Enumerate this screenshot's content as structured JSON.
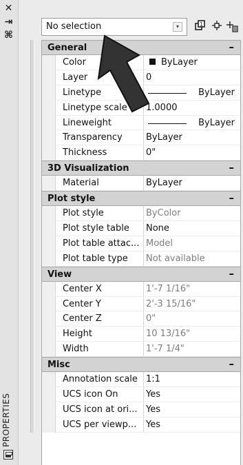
{
  "palette": {
    "title": "PROPERTIES",
    "strip_icons": [
      "close-icon",
      "auto-hide-icon",
      "properties-settings-icon"
    ]
  },
  "toolbar": {
    "selection_value": "No selection",
    "buttons": [
      "toggle-pickadd-icon",
      "select-objects-icon",
      "quick-select-icon"
    ]
  },
  "categories": [
    {
      "label": "General",
      "rows": [
        {
          "name": "Color",
          "value": "ByLayer",
          "type": "color"
        },
        {
          "name": "Layer",
          "value": "0"
        },
        {
          "name": "Linetype",
          "value": "ByLayer",
          "type": "linetype"
        },
        {
          "name": "Linetype scale",
          "value": "1.0000"
        },
        {
          "name": "Lineweight",
          "value": "ByLayer",
          "type": "linetype"
        },
        {
          "name": "Transparency",
          "value": "ByLayer"
        },
        {
          "name": "Thickness",
          "value": "0\""
        }
      ]
    },
    {
      "label": "3D Visualization",
      "rows": [
        {
          "name": "Material",
          "value": "ByLayer"
        }
      ]
    },
    {
      "label": "Plot style",
      "rows": [
        {
          "name": "Plot style",
          "value": "ByColor",
          "gray": true
        },
        {
          "name": "Plot style table",
          "value": "None"
        },
        {
          "name": "Plot table attac...",
          "value": "Model",
          "gray": true
        },
        {
          "name": "Plot table type",
          "value": "Not available",
          "gray": true
        }
      ]
    },
    {
      "label": "View",
      "rows": [
        {
          "name": "Center X",
          "value": "1'-7 1/16\"",
          "gray": true
        },
        {
          "name": "Center Y",
          "value": "2'-3 15/16\"",
          "gray": true
        },
        {
          "name": "Center Z",
          "value": "0\"",
          "gray": true
        },
        {
          "name": "Height",
          "value": "10 13/16\"",
          "gray": true
        },
        {
          "name": "Width",
          "value": "1'-7 1/4\"",
          "gray": true
        }
      ]
    },
    {
      "label": "Misc",
      "rows": [
        {
          "name": "Annotation scale",
          "value": "1:1"
        },
        {
          "name": "UCS icon On",
          "value": "Yes"
        },
        {
          "name": "UCS icon at ori...",
          "value": "Yes"
        },
        {
          "name": "UCS per viewp...",
          "value": "Yes"
        }
      ]
    }
  ],
  "collapse_symbol": "–"
}
